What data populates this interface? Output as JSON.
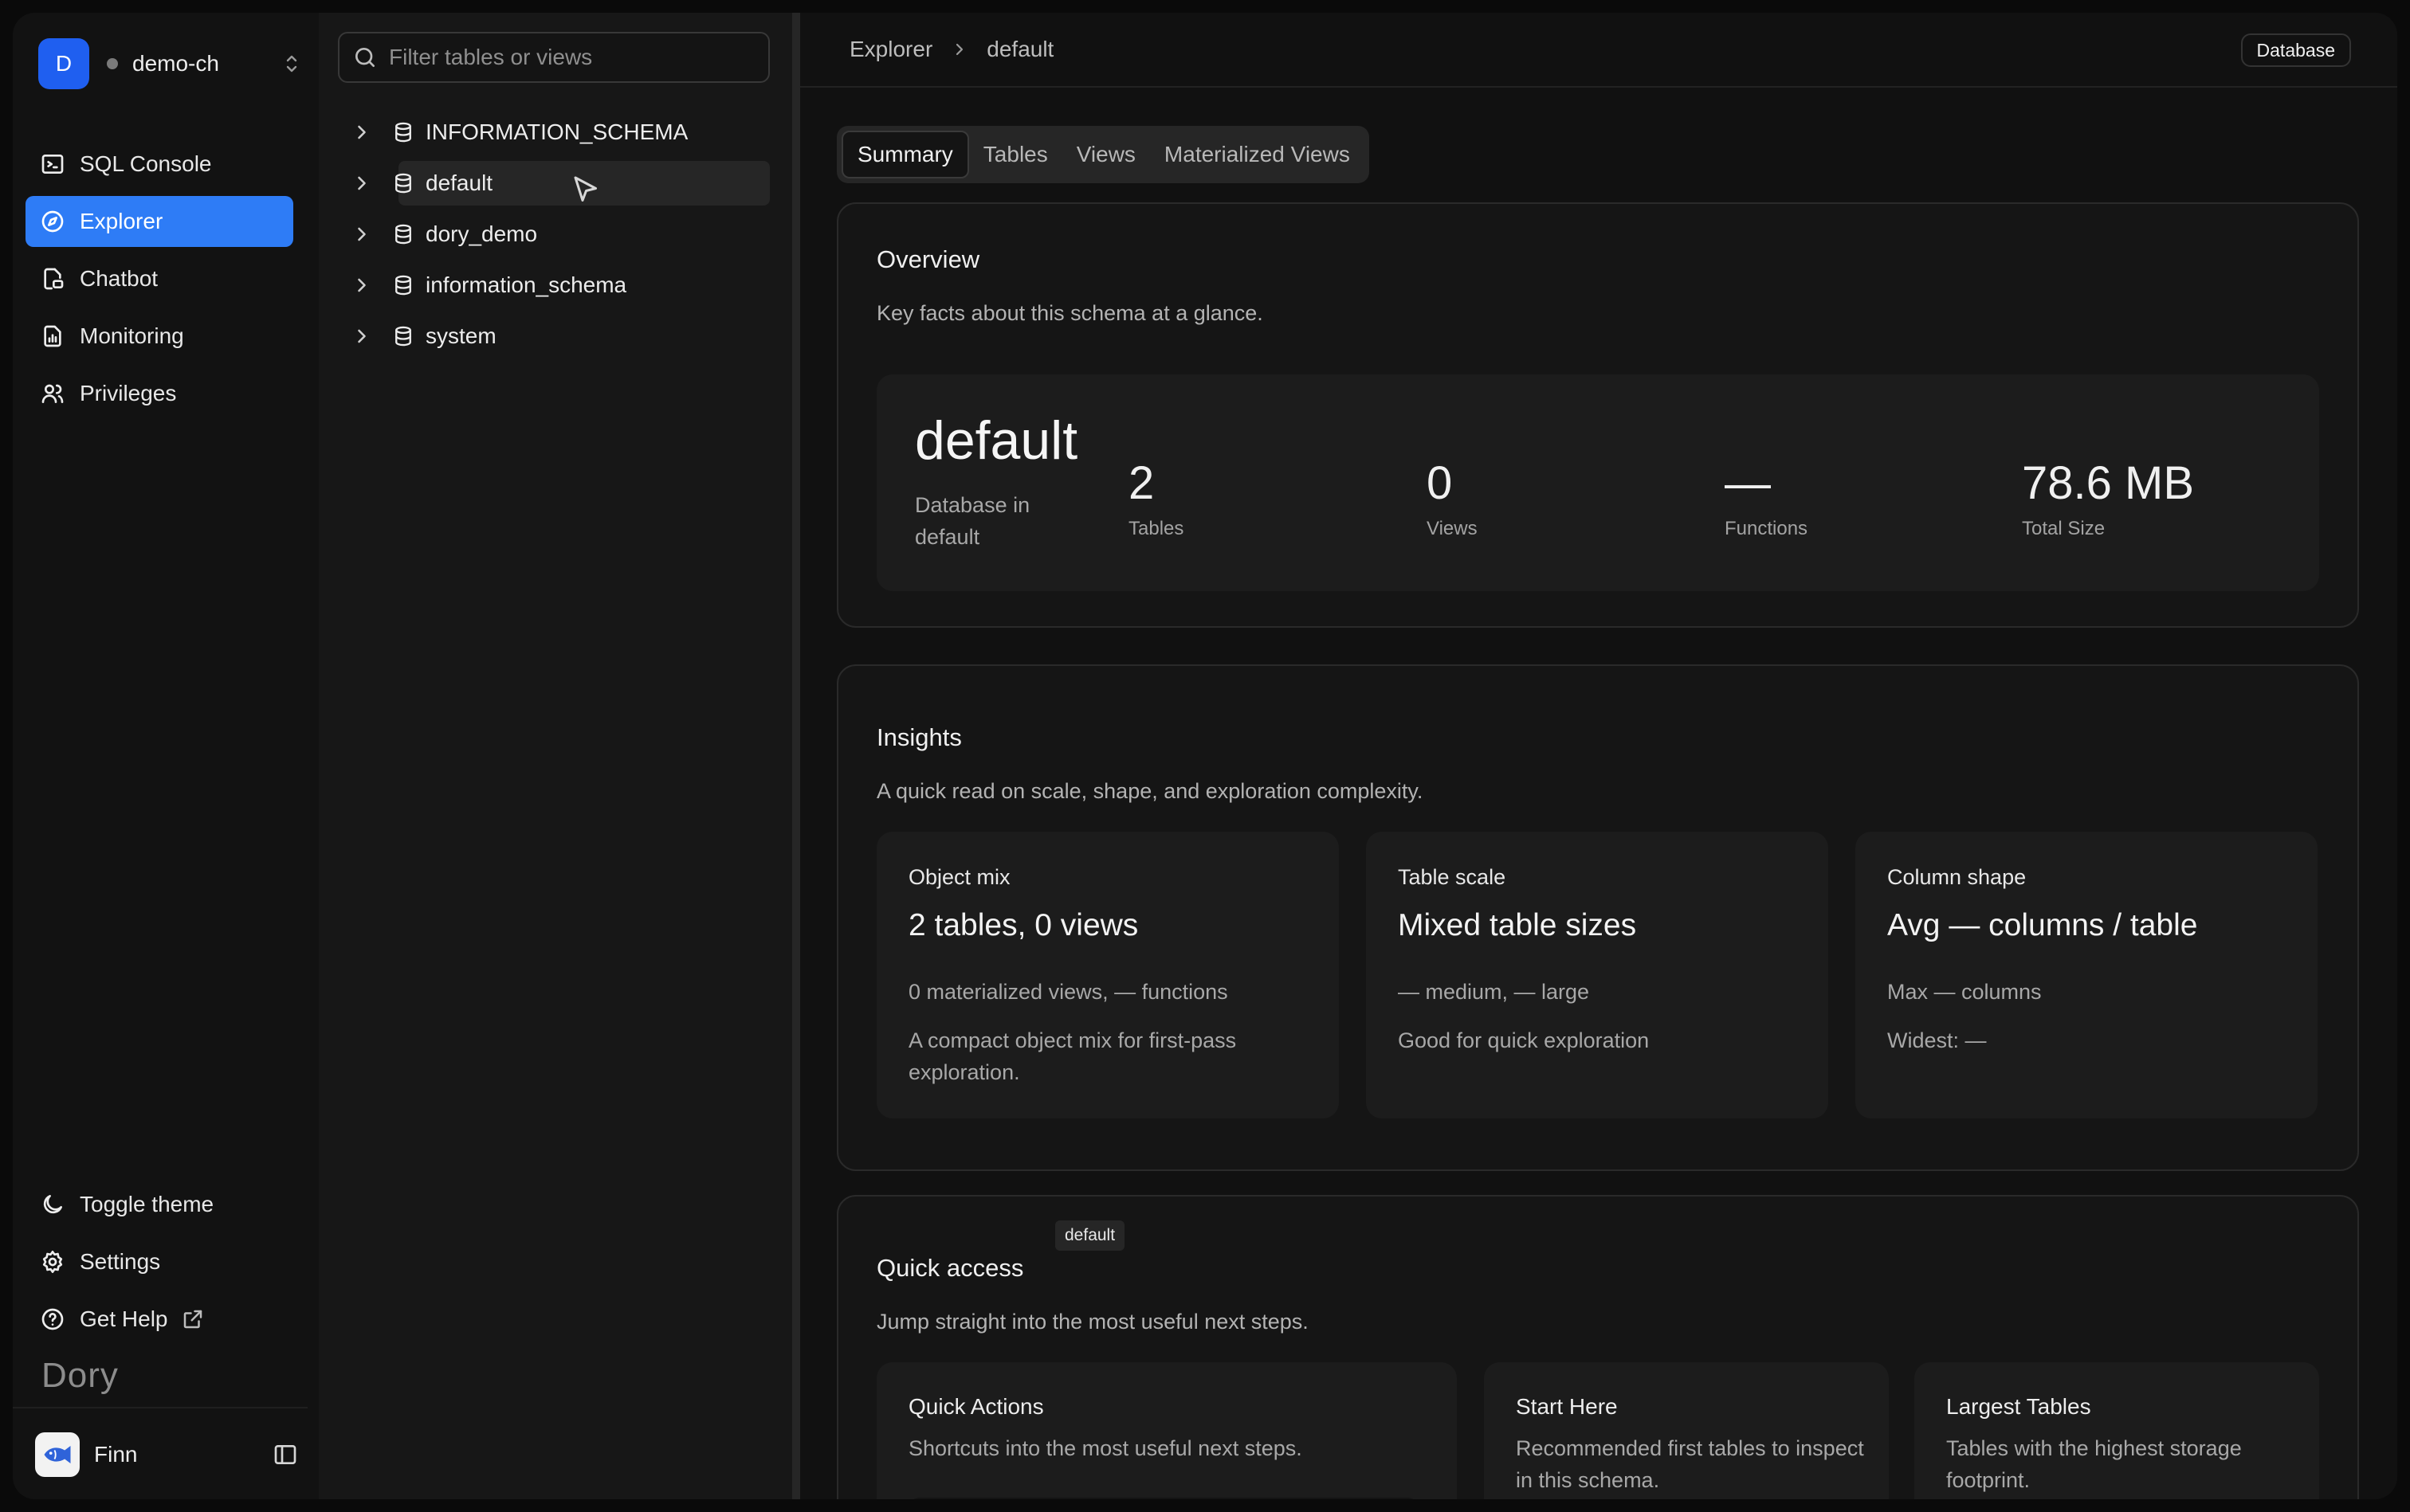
{
  "workspace": {
    "initial": "D",
    "name": "demo-ch"
  },
  "nav": {
    "items": [
      {
        "label": "SQL Console",
        "icon": "terminal-icon"
      },
      {
        "label": "Explorer",
        "icon": "compass-icon"
      },
      {
        "label": "Chatbot",
        "icon": "chat-doc-icon"
      },
      {
        "label": "Monitoring",
        "icon": "chart-doc-icon"
      },
      {
        "label": "Privileges",
        "icon": "users-icon"
      }
    ],
    "bottom": [
      {
        "label": "Toggle theme",
        "icon": "moon-icon"
      },
      {
        "label": "Settings",
        "icon": "gear-icon"
      },
      {
        "label": "Get Help",
        "icon": "help-icon"
      }
    ],
    "brand": "Dory",
    "user": "Finn"
  },
  "tree": {
    "filter_placeholder": "Filter tables or views",
    "items": [
      "INFORMATION_SCHEMA",
      "default",
      "dory_demo",
      "information_schema",
      "system"
    ]
  },
  "breadcrumb": {
    "root": "Explorer",
    "current": "default"
  },
  "header_badge": "Database",
  "tabs": [
    "Summary",
    "Tables",
    "Views",
    "Materialized Views"
  ],
  "overview": {
    "title": "Overview",
    "subtitle": "Key facts about this schema at a glance.",
    "schema": "default",
    "schema_sub": "Database in default",
    "stats": [
      {
        "value": "2",
        "label": "Tables"
      },
      {
        "value": "0",
        "label": "Views"
      },
      {
        "value": "—",
        "label": "Functions"
      },
      {
        "value": "78.6 MB",
        "label": "Total Size"
      }
    ]
  },
  "insights": {
    "title": "Insights",
    "subtitle": "A quick read on scale, shape, and exploration complexity.",
    "cards": [
      {
        "kicker": "Object mix",
        "headline": "2 tables, 0 views",
        "line1": "0 materialized views, — functions",
        "line2": "A compact object mix for first-pass exploration."
      },
      {
        "kicker": "Table scale",
        "headline": "Mixed table sizes",
        "line1": "— medium, — large",
        "line2": "Good for quick exploration"
      },
      {
        "kicker": "Column shape",
        "headline": "Avg — columns / table",
        "line1": "Max — columns",
        "line2": "Widest: —"
      }
    ]
  },
  "quick_access": {
    "tag": "default",
    "title": "Quick access",
    "subtitle": "Jump straight into the most useful next steps.",
    "cards": [
      {
        "title": "Quick Actions",
        "text": "Shortcuts into the most useful next steps."
      },
      {
        "title": "Start Here",
        "text": "Recommended first tables to inspect in this schema."
      },
      {
        "title": "Largest Tables",
        "text": "Tables with the highest storage footprint."
      }
    ]
  }
}
